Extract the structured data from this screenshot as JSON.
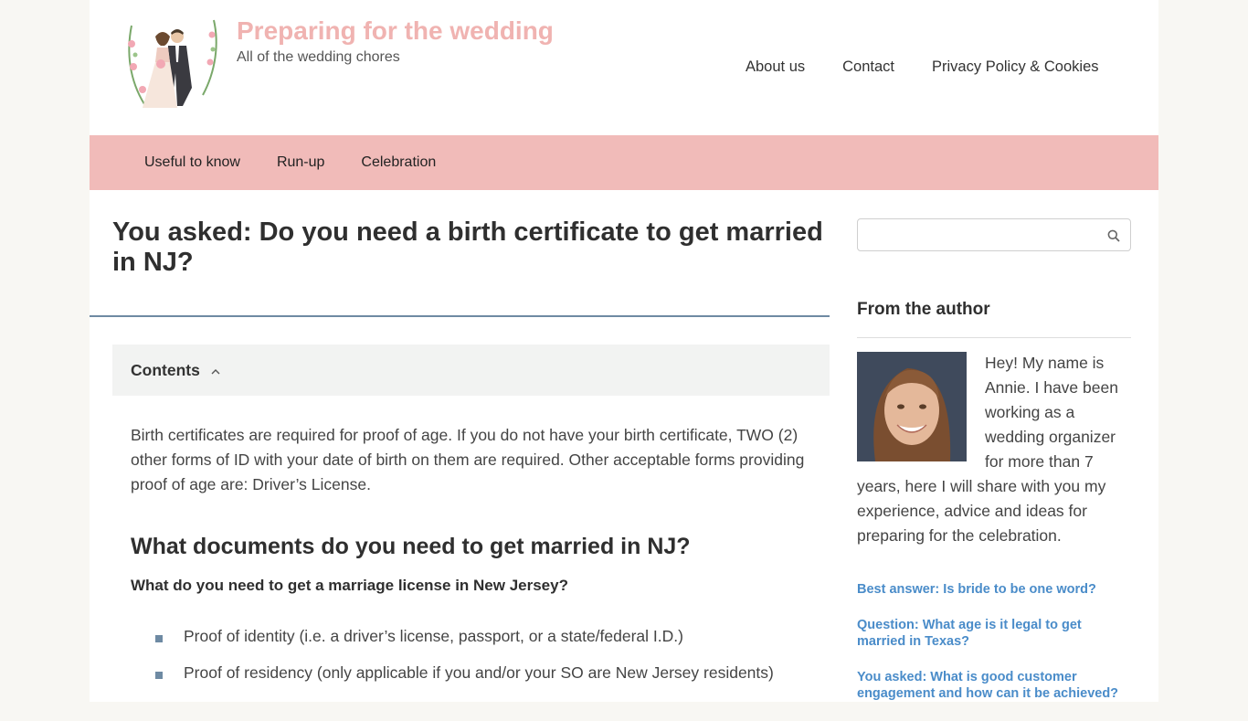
{
  "header": {
    "site_title": "Preparing for the wedding",
    "tagline": "All of the wedding chores",
    "top_nav": [
      "About us",
      "Contact",
      "Privacy Policy & Cookies"
    ]
  },
  "main_nav": [
    "Useful to know",
    "Run-up",
    "Celebration"
  ],
  "article": {
    "title": "You asked: Do you need a birth certificate to get married in NJ?",
    "toc_label": "Contents",
    "intro": "Birth certificates are required for proof of age. If you do not have your birth certificate, TWO (2) other forms of ID with your date of birth on them are required. Other acceptable forms providing proof of age are: Driver’s License.",
    "h2": "What documents do you need to get married in NJ?",
    "subheading": "What do you need to get a marriage license in New Jersey?",
    "list": [
      "Proof of identity (i.e. a driver’s license, passport, or a state/federal I.D.)",
      "Proof of residency (only applicable if you and/or your SO are New Jersey residents)"
    ]
  },
  "sidebar": {
    "search_placeholder": "",
    "widget_title": "From the author",
    "author_text": "Hey! My name is Annie. I have been working as a wedding organizer for more than 7 years, here I will share with you my experience, advice and ideas for preparing for the celebration.",
    "related": [
      "Best answer: Is bride to be one word?",
      "Question: What age is it legal to get married in Texas?",
      "You asked: What is good customer engagement and how can it be achieved?"
    ]
  },
  "colors": {
    "brand_pink": "#f1bbb9",
    "title_pink": "#f0b3b1",
    "accent_blue": "#6e8aa3",
    "link_blue": "#4a8cc9"
  }
}
